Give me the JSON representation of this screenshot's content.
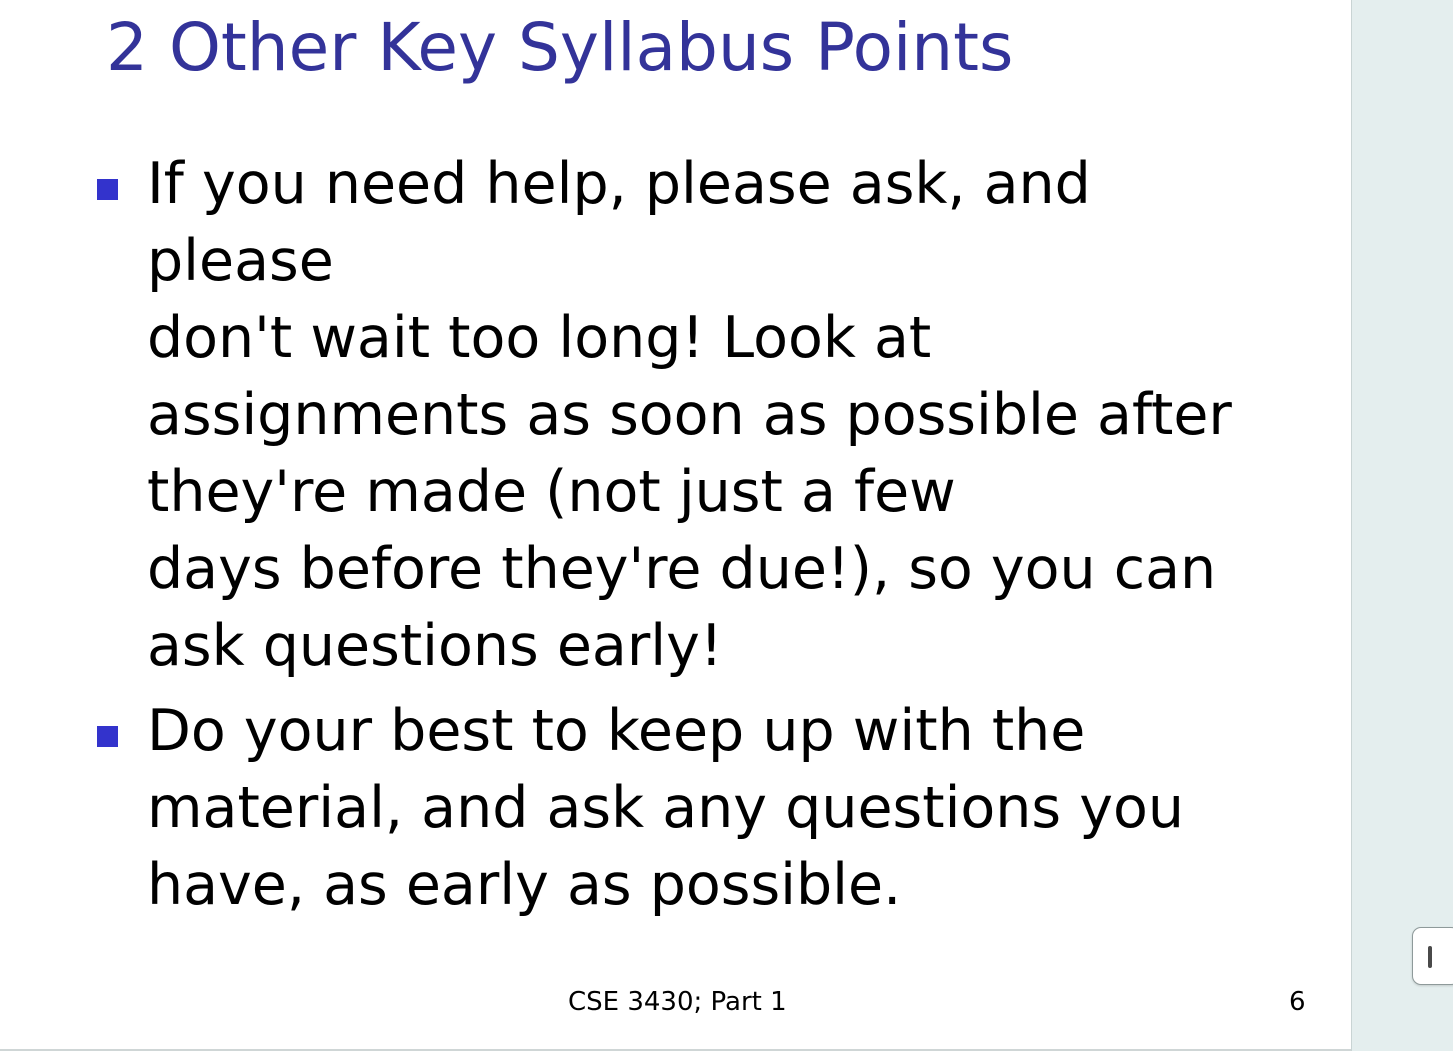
{
  "slide": {
    "title": "2 Other Key Syllabus Points",
    "bullets": [
      {
        "text": "If you need help, please ask, and please\ndon't wait too long! Look at\nassignments as soon as possible after\nthey're made (not just a few\ndays before they're due!), so you can\nask questions early!"
      },
      {
        "text": "Do your best to keep up with the\nmaterial, and ask any questions you\nhave, as early as possible."
      }
    ],
    "footer": "CSE 3430; Part 1",
    "page_number": "6"
  },
  "colors": {
    "title": "#333399",
    "bullet_marker": "#3333cc",
    "side_panel": "#e4eeee"
  },
  "icons": {
    "panel_handle": "grip-handle-icon"
  }
}
